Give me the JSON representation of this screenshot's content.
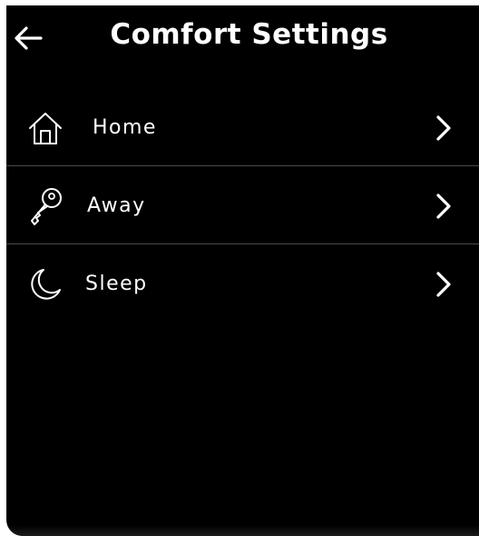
{
  "header": {
    "title": "Comfort Settings",
    "back_icon": "arrow-left-icon"
  },
  "menu": {
    "items": [
      {
        "label": "Home",
        "icon": "house-icon",
        "chevron": "chevron-right-icon"
      },
      {
        "label": "Away",
        "icon": "key-icon",
        "chevron": "chevron-right-icon"
      },
      {
        "label": "Sleep",
        "icon": "moon-icon",
        "chevron": "chevron-right-icon"
      }
    ]
  },
  "colors": {
    "background": "#000000",
    "text": "#ffffff",
    "divider": "#4a4a4a"
  }
}
